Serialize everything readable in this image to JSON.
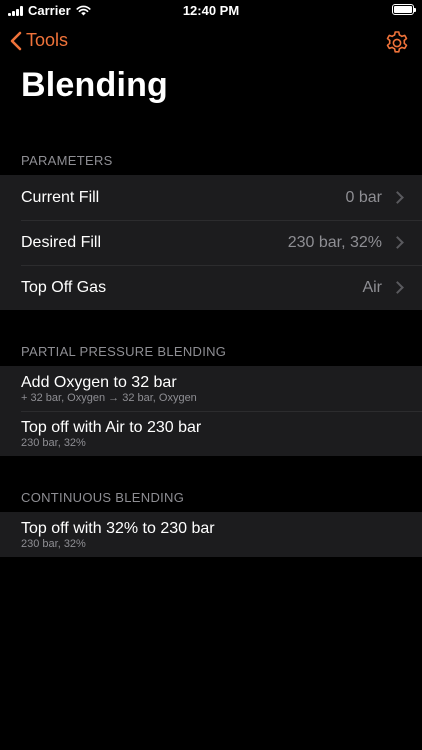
{
  "status_bar": {
    "carrier": "Carrier",
    "time": "12:40 PM"
  },
  "nav": {
    "back_label": "Tools",
    "title": "Blending",
    "accent_color": "#f0733a"
  },
  "parameters": {
    "header": "PARAMETERS",
    "rows": [
      {
        "label": "Current Fill",
        "value": "0 bar"
      },
      {
        "label": "Desired Fill",
        "value": "230 bar, 32%"
      },
      {
        "label": "Top Off Gas",
        "value": "Air"
      }
    ]
  },
  "partial_pressure": {
    "header": "PARTIAL PRESSURE BLENDING",
    "rows": [
      {
        "label": "Add Oxygen to 32 bar",
        "sub": "+ 32 bar, Oxygen → 32 bar, Oxygen"
      },
      {
        "label": "Top off with Air to 230 bar",
        "sub": "230 bar, 32%"
      }
    ]
  },
  "continuous": {
    "header": "CONTINUOUS BLENDING",
    "rows": [
      {
        "label": "Top off with 32% to 230 bar",
        "sub": "230 bar, 32%"
      }
    ]
  }
}
